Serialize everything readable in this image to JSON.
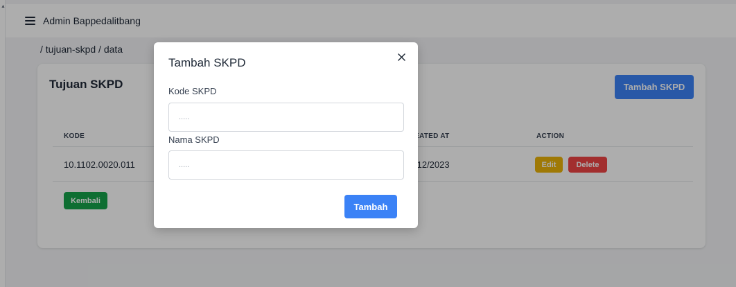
{
  "app": {
    "title": "Admin Bappedalitbang"
  },
  "breadcrumb": "/ tujuan-skpd / data",
  "card": {
    "title": "Tujuan SKPD",
    "add_button": "Tambah SKPD",
    "back_button": "Kembali"
  },
  "table": {
    "headers": [
      "KODE",
      "EATED AT",
      "ACTION"
    ],
    "rows": [
      {
        "kode": "10.1102.0020.011",
        "created_at": "/12/2023",
        "edit_label": "Edit",
        "delete_label": "Delete"
      }
    ]
  },
  "modal": {
    "title": "Tambah SKPD",
    "close_icon": "close-icon",
    "fields": [
      {
        "label": "Kode SKPD",
        "placeholder": ".....",
        "value": ""
      },
      {
        "label": "Nama SKPD",
        "placeholder": ".....",
        "value": ""
      }
    ],
    "submit_label": "Tambah"
  },
  "colors": {
    "primary": "#3b82f6",
    "warning": "#eab308",
    "danger": "#ef4444",
    "success": "#16a34a"
  }
}
